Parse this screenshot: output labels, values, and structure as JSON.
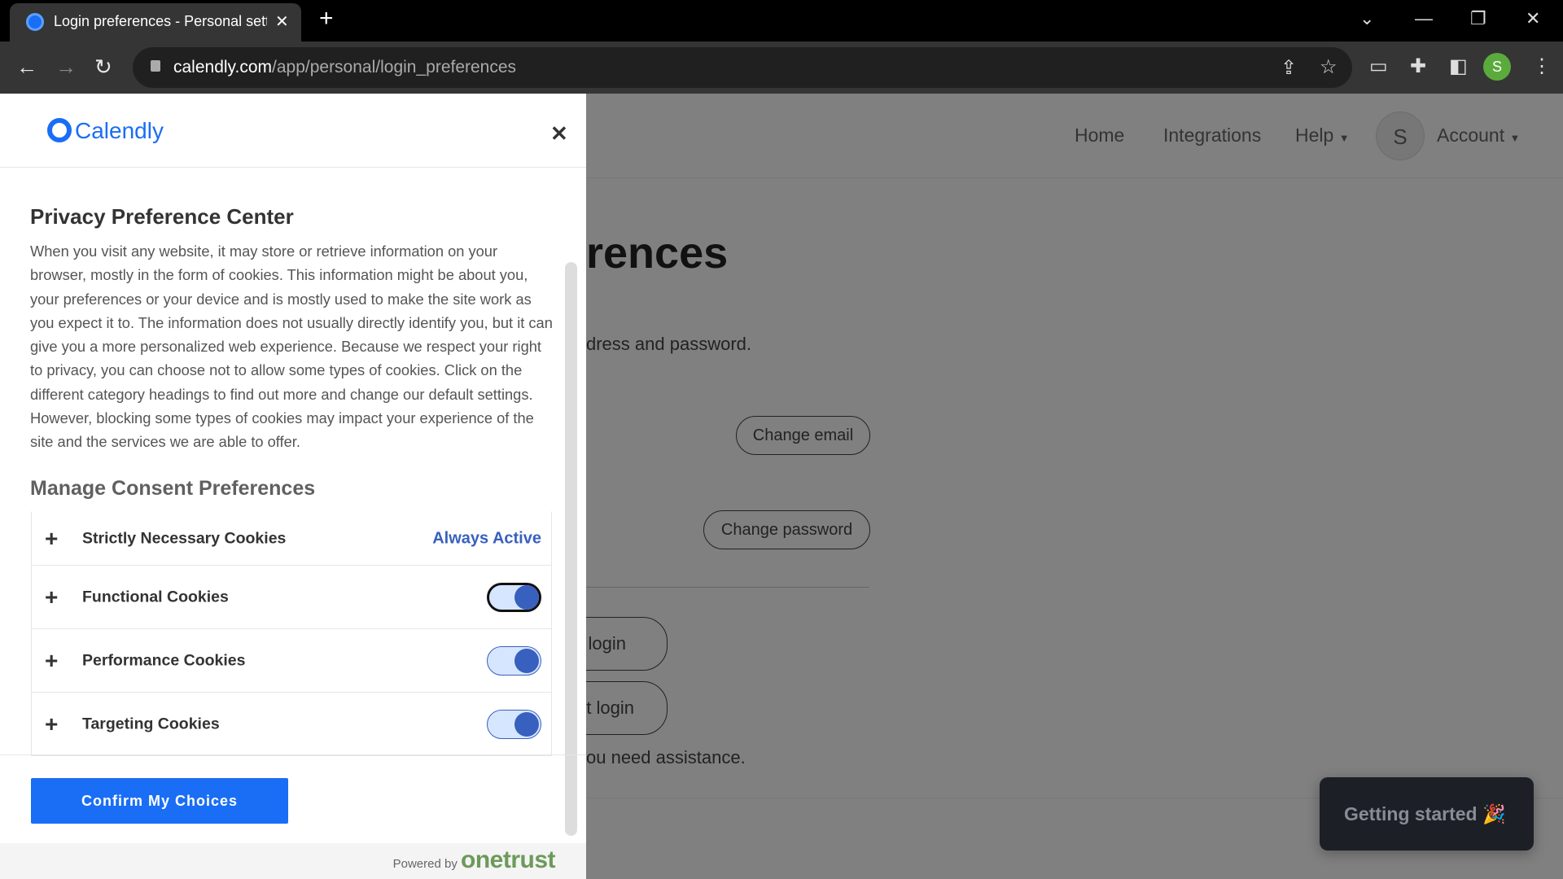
{
  "browser": {
    "tab_title": "Login preferences - Personal settings",
    "url_host": "calendly.com",
    "url_path": "/app/personal/login_preferences",
    "profile_initial": "S"
  },
  "page": {
    "nav": {
      "home": "Home",
      "integrations": "Integrations",
      "help": "Help",
      "avatar_initial": "S",
      "account": "Account"
    },
    "title_partial": "rences",
    "desc_partial": "dress and password.",
    "change_email": "Change email",
    "change_password": "Change password",
    "login_btn_1": "login",
    "login_btn_2": "t login",
    "help_partial": "ou need assistance.",
    "getting_started": "Getting started"
  },
  "modal": {
    "logo_text": "Calendly",
    "title": "Privacy Preference Center",
    "body": "When you visit any website, it may store or retrieve information on your browser, mostly in the form of cookies. This information might be about you, your preferences or your device and is mostly used to make the site work as you expect it to. The information does not usually directly identify you, but it can give you a more personalized web experience. Because we respect your right to privacy, you can choose not to allow some types of cookies. Click on the different category headings to find out more and change our default settings. However, blocking some types of cookies may impact your experience of the site and the services we are able to offer.",
    "manage_title": "Manage Consent Preferences",
    "categories": [
      {
        "label": "Strictly Necessary Cookies",
        "status": "Always Active"
      },
      {
        "label": "Functional Cookies",
        "enabled": true
      },
      {
        "label": "Performance Cookies",
        "enabled": true
      },
      {
        "label": "Targeting Cookies",
        "enabled": true
      }
    ],
    "confirm": "Confirm My Choices",
    "powered_by": "Powered by",
    "onetrust": "onetrust"
  },
  "colors": {
    "accent": "#1a6ef5",
    "toggle": "#3860be",
    "onetrust": "#6c9a5a"
  }
}
